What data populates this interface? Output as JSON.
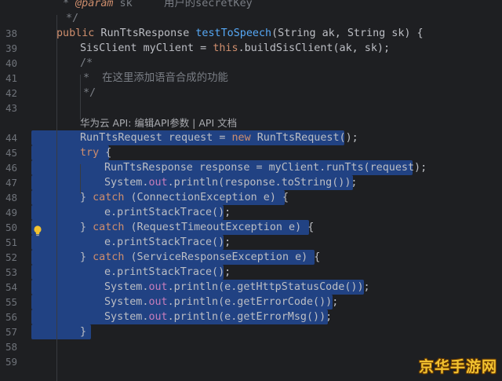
{
  "lines": [
    {
      "n": "",
      "indent": 80,
      "html": "<span class='cm'>* </span><span class='tag'>@param</span><span class='cm'> sk</span><span class='cm'>     用户的secretKey</span>"
    },
    {
      "n": "",
      "indent": 84,
      "html": "<span class='cm'>*/</span>"
    },
    {
      "n": "38",
      "indent": 72,
      "html": "<span class='kw'>public</span> RunTtsResponse <span class='fn'>testToSpeech</span>(String ak, String sk) {"
    },
    {
      "n": "39",
      "indent": 102,
      "html": "SisClient myClient = <span class='kw'>this</span>.buildSisClient(ak, sk);"
    },
    {
      "n": "40",
      "indent": 102,
      "html": "<span class='cm'>/*</span>"
    },
    {
      "n": "41",
      "indent": 106,
      "html": "<span class='cm'>*  在这里添加语音合成的功能</span>"
    },
    {
      "n": "42",
      "indent": 106,
      "html": "<span class='cm'>*/</span>"
    },
    {
      "n": "43",
      "indent": 102,
      "html": ""
    },
    {
      "n": "",
      "indent": 102,
      "html": "<span class='inlay'>华为云 API: 编辑API参数 | API 文档</span>"
    },
    {
      "n": "44",
      "indent": 102,
      "html": "RunTtsRequest request = <span class='kw'>new</span> RunTtsRequest();"
    },
    {
      "n": "45",
      "indent": 102,
      "html": "<span class='kw'>try</span> {"
    },
    {
      "n": "46",
      "indent": 133,
      "html": "RunTtsResponse response = myClient.runTts(request);"
    },
    {
      "n": "47",
      "indent": 133,
      "html": "System.<span class='field'>out</span>.println(response.toString());"
    },
    {
      "n": "48",
      "indent": 102,
      "html": "} <span class='kw'>catch</span> (ConnectionException e) {"
    },
    {
      "n": "49",
      "indent": 133,
      "html": "e.printStackTrace();"
    },
    {
      "n": "50",
      "indent": 102,
      "html": "} <span class='kw'>catch</span> (RequestTimeoutException e) {"
    },
    {
      "n": "51",
      "indent": 133,
      "html": "e.printStackTrace();"
    },
    {
      "n": "52",
      "indent": 102,
      "html": "} <span class='kw'>catch</span> (ServiceResponseException e) {"
    },
    {
      "n": "53",
      "indent": 133,
      "html": "e.printStackTrace();"
    },
    {
      "n": "54",
      "indent": 133,
      "html": "System.<span class='field'>out</span>.println(e.getHttpStatusCode());"
    },
    {
      "n": "55",
      "indent": 133,
      "html": "System.<span class='field'>out</span>.println(e.getErrorCode());"
    },
    {
      "n": "56",
      "indent": 133,
      "html": "System.<span class='field'>out</span>.println(e.getErrorMsg());"
    },
    {
      "n": "57",
      "indent": 102,
      "html": "}"
    },
    {
      "n": "58",
      "indent": 102,
      "html": ""
    },
    {
      "n": "59",
      "indent": 102,
      "html": ""
    }
  ],
  "selection": {
    "from_line": "44",
    "to_line": "57"
  },
  "watermark": "京华手游网",
  "colors": {
    "selection": "#214283",
    "keyword": "#cf8e6d",
    "function": "#56a8f5",
    "comment": "#7a7e85",
    "field": "#c77dbb"
  }
}
